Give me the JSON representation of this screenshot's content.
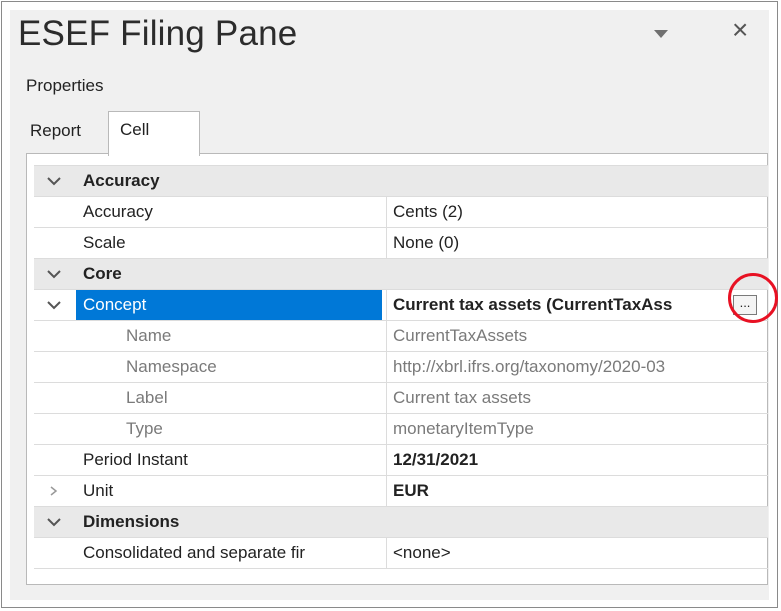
{
  "pane": {
    "title": "ESEF Filing Pane",
    "section": "Properties"
  },
  "tabs": [
    {
      "label": "Report"
    },
    {
      "label": "Cell"
    }
  ],
  "rows": [
    {
      "name": "Accuracy",
      "value": ""
    },
    {
      "name": "Accuracy",
      "value": "Cents (2)"
    },
    {
      "name": "Scale",
      "value": "None (0)"
    },
    {
      "name": "Core",
      "value": ""
    },
    {
      "name": "Concept",
      "value": "Current tax assets (CurrentTaxAss"
    },
    {
      "name": "Name",
      "value": "CurrentTaxAssets"
    },
    {
      "name": "Namespace",
      "value": "http://xbrl.ifrs.org/taxonomy/2020-03"
    },
    {
      "name": "Label",
      "value": "Current tax assets"
    },
    {
      "name": "Type",
      "value": "monetaryItemType"
    },
    {
      "name": "Period Instant",
      "value": "12/31/2021"
    },
    {
      "name": "Unit",
      "value": "EUR"
    },
    {
      "name": "Dimensions",
      "value": ""
    },
    {
      "name": "Consolidated and separate fir",
      "value": "<none>"
    }
  ],
  "ellipsis_label": "...",
  "colors": {
    "selection": "#0078d7",
    "highlight_circle": "#e81123",
    "header_row": "#e9e9e9"
  },
  "icons": {
    "pane_menu": "chevron-down-icon",
    "close": "close-icon",
    "expand": "chevron-down-icon",
    "collapse": "chevron-right-icon"
  }
}
